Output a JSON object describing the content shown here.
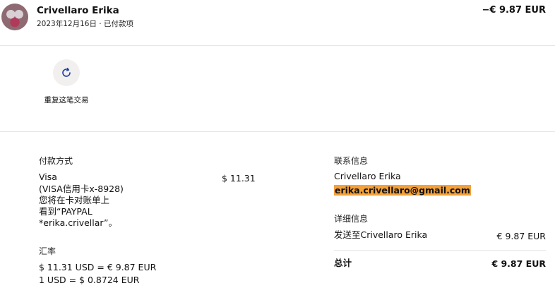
{
  "header": {
    "name": "Crivellaro Erika",
    "meta": "2023年12月16日 · 已付款项",
    "amount": "−€ 9.87 EUR"
  },
  "action": {
    "repeat_label": "重复这笔交易"
  },
  "payment": {
    "label": "付款方式",
    "method_lines": [
      "Visa",
      "(VISA信用卡x-8928)",
      "您将在卡对账单上",
      "看到“PAYPAL",
      "*erika.crivellar”。"
    ],
    "amount": "$ 11.31"
  },
  "exchange": {
    "label": "汇率",
    "line1": "$ 11.31 USD = € 9.87 EUR",
    "line2": "1 USD = $ 0.8724 EUR"
  },
  "contact": {
    "label": "联系信息",
    "name": "Crivellaro Erika",
    "email": "erika.crivellaro@gmail.com"
  },
  "details": {
    "label": "详细信息",
    "send_to": "发送至Crivellaro Erika",
    "send_amount": "€ 9.87 EUR",
    "total_label": "总计",
    "total_amount": "€ 9.87 EUR"
  },
  "colors": {
    "email_highlight": "#f4a13a",
    "icon_blue": "#1d3fa8"
  },
  "icons": {
    "avatar": "user-avatar",
    "repeat": "refresh-icon"
  }
}
